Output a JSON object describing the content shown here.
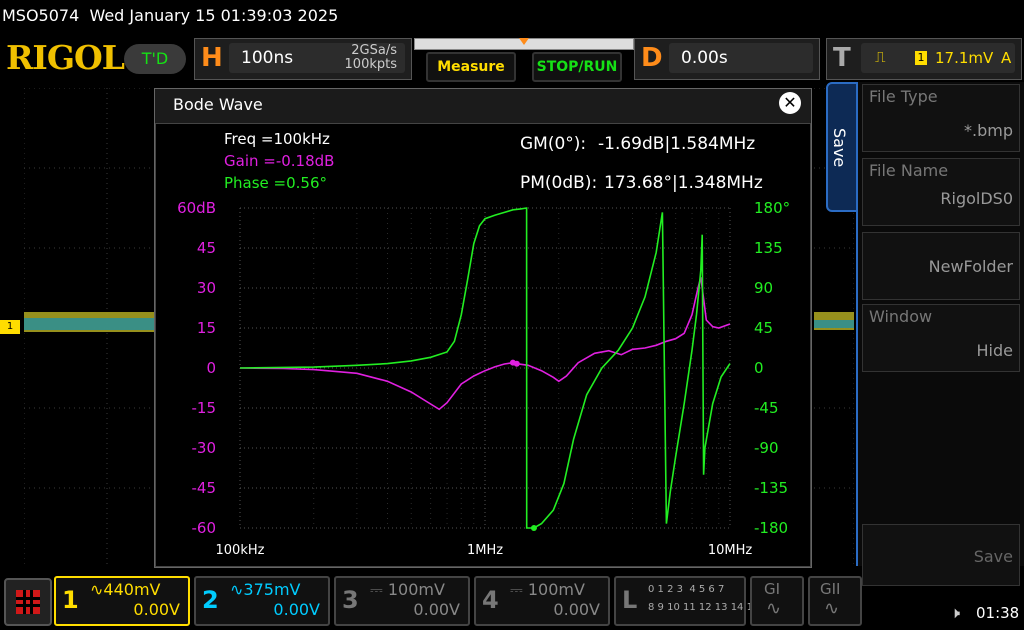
{
  "titlebar": {
    "model": "MSO5074",
    "datetime": "Wed January 15 01:39:03 2025"
  },
  "logo": {
    "text": "RIGOL",
    "mode_badge": "T'D"
  },
  "horizontal": {
    "letter": "H",
    "timebase": "100ns",
    "sample_rate": "2GSa/s",
    "points": "100kpts"
  },
  "buttons": {
    "measure": "Measure",
    "stop_run": "STOP/RUN"
  },
  "delay": {
    "letter": "D",
    "value": "0.00s"
  },
  "trigger": {
    "letter": "T",
    "channel": "1",
    "level": "17.1mV",
    "mode": "A"
  },
  "dialog": {
    "title": "Bode Wave",
    "freq": "Freq =100kHz",
    "gain": "Gain =-0.18dB",
    "phase": "Phase =0.56°",
    "gm_label": "GM(0°):",
    "gm_value": "-1.69dB|1.584MHz",
    "pm_label": "PM(0dB):",
    "pm_value": "173.68°|1.348MHz"
  },
  "chart_data": {
    "type": "line",
    "x_scale": "log",
    "x_range": [
      100000,
      10000000
    ],
    "x_ticks": [
      {
        "v": 100000,
        "label": "100kHz"
      },
      {
        "v": 1000000,
        "label": "1MHz"
      },
      {
        "v": 10000000,
        "label": "10MHz"
      }
    ],
    "y_left": {
      "range": [
        -60,
        60
      ],
      "ticks": [
        "60dB",
        "45",
        "30",
        "15",
        "0",
        "-15",
        "-30",
        "-45",
        "-60"
      ]
    },
    "y_right": {
      "range": [
        -180,
        180
      ],
      "ticks": [
        "180°",
        "135",
        "90",
        "45",
        "0",
        "-45",
        "-90",
        "-135",
        "-180"
      ]
    },
    "series": [
      {
        "id": "gain",
        "color": "#e020e0",
        "axis": "left",
        "points": [
          [
            100000,
            0
          ],
          [
            150000,
            -0.2
          ],
          [
            200000,
            -0.6
          ],
          [
            300000,
            -2
          ],
          [
            400000,
            -5
          ],
          [
            500000,
            -9
          ],
          [
            600000,
            -13.5
          ],
          [
            650000,
            -15.5
          ],
          [
            700000,
            -13
          ],
          [
            800000,
            -6
          ],
          [
            900000,
            -3
          ],
          [
            1000000,
            -1
          ],
          [
            1100000,
            0.5
          ],
          [
            1200000,
            1.5
          ],
          [
            1300000,
            2
          ],
          [
            1348000,
            1.6
          ],
          [
            1500000,
            1
          ],
          [
            1700000,
            -1
          ],
          [
            1900000,
            -3.5
          ],
          [
            2000000,
            -5
          ],
          [
            2150000,
            -3
          ],
          [
            2400000,
            2
          ],
          [
            2800000,
            5.5
          ],
          [
            3200000,
            6.5
          ],
          [
            3600000,
            5
          ],
          [
            4000000,
            7
          ],
          [
            4500000,
            7.5
          ],
          [
            5000000,
            8.5
          ],
          [
            5500000,
            10
          ],
          [
            6000000,
            11
          ],
          [
            6500000,
            13
          ],
          [
            7000000,
            20
          ],
          [
            7400000,
            30
          ],
          [
            7600000,
            34
          ],
          [
            7800000,
            26
          ],
          [
            8000000,
            18
          ],
          [
            8500000,
            15.5
          ],
          [
            9000000,
            15
          ],
          [
            10000000,
            16.5
          ]
        ]
      },
      {
        "id": "phase",
        "color": "#22ee22",
        "axis": "right",
        "points": [
          [
            100000,
            0
          ],
          [
            200000,
            1
          ],
          [
            300000,
            3
          ],
          [
            400000,
            5
          ],
          [
            500000,
            8
          ],
          [
            600000,
            12
          ],
          [
            700000,
            18
          ],
          [
            750000,
            30
          ],
          [
            800000,
            60
          ],
          [
            850000,
            100
          ],
          [
            900000,
            140
          ],
          [
            950000,
            160
          ],
          [
            1000000,
            168
          ],
          [
            1100000,
            172
          ],
          [
            1200000,
            175
          ],
          [
            1300000,
            178
          ],
          [
            1400000,
            179
          ],
          [
            1479000,
            180
          ],
          [
            1480000,
            -180
          ],
          [
            1584000,
            -180
          ],
          [
            1700000,
            -175
          ],
          [
            1900000,
            -160
          ],
          [
            2100000,
            -130
          ],
          [
            2300000,
            -80
          ],
          [
            2600000,
            -30
          ],
          [
            3000000,
            0
          ],
          [
            3500000,
            20
          ],
          [
            4000000,
            45
          ],
          [
            4500000,
            80
          ],
          [
            5000000,
            130
          ],
          [
            5300000,
            175
          ],
          [
            5500000,
            -175
          ],
          [
            5700000,
            -140
          ],
          [
            6000000,
            -100
          ],
          [
            6500000,
            -40
          ],
          [
            7000000,
            20
          ],
          [
            7300000,
            60
          ],
          [
            7600000,
            110
          ],
          [
            7700000,
            150
          ],
          [
            7800000,
            -120
          ],
          [
            7900000,
            -90
          ],
          [
            8500000,
            -40
          ],
          [
            9200000,
            -10
          ],
          [
            10000000,
            5
          ]
        ]
      }
    ],
    "markers": [
      {
        "series": "gain",
        "x": 1348000,
        "y": 1.6
      },
      {
        "series": "phase",
        "x": 1584000,
        "y": -180
      },
      {
        "series": "gain",
        "x": 1300000,
        "y": 2
      }
    ]
  },
  "right_panel": {
    "tab_label": "Save",
    "items": [
      {
        "label": "File Type",
        "value": "*.bmp"
      },
      {
        "label": "File Name",
        "value": "RigolDS0"
      },
      {
        "label": "",
        "value": "NewFolder"
      },
      {
        "label": "Window",
        "value": "Hide"
      }
    ],
    "save_button": "Save"
  },
  "channels": [
    {
      "num": "1",
      "scale": "440mV",
      "offset": "0.00V",
      "color": "#ffdd00",
      "active": true
    },
    {
      "num": "2",
      "scale": "375mV",
      "offset": "0.00V",
      "color": "#00ccff",
      "active": false
    },
    {
      "num": "3",
      "scale": "100mV",
      "offset": "0.00V",
      "color": "#777",
      "active": false
    },
    {
      "num": "4",
      "scale": "100mV",
      "offset": "0.00V",
      "color": "#777",
      "active": false
    }
  ],
  "logic": {
    "letter": "L",
    "row1": "0 1 2 3  4 5 6 7",
    "row2": "8 9 10 11 12 13 14 15"
  },
  "g1": "GI",
  "g2": "GII",
  "status_time": "01:38",
  "left_marker": "1"
}
